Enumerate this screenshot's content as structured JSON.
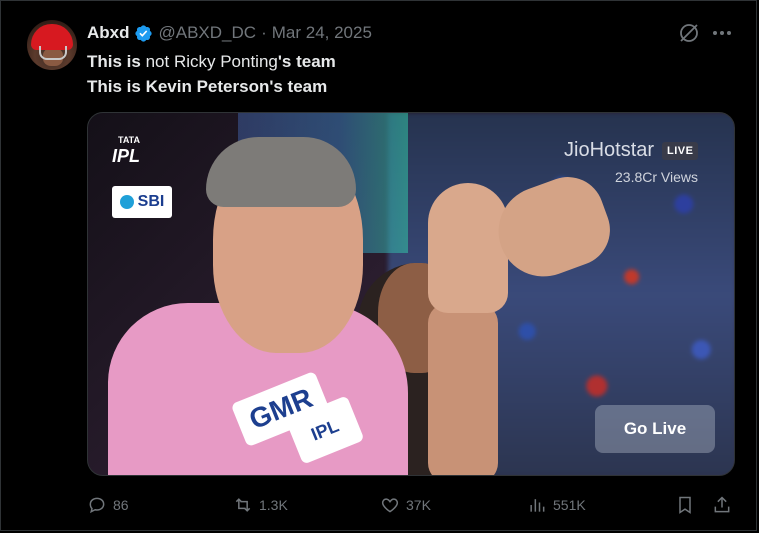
{
  "author": {
    "name": "Abxd",
    "handle": "@ABXD_DC",
    "separator": "·",
    "date": "Mar 24, 2025",
    "verified": true
  },
  "text": {
    "line1_bold_a": "This is",
    "line1_normal": " not Ricky Ponting",
    "line1_bold_b": "'s team",
    "line2": "This is Kevin Peterson's team"
  },
  "media": {
    "brand": "JioHotstar",
    "live_badge": "LIVE",
    "views": "23.8Cr Views",
    "go_live": "Go Live",
    "ipl_tata": "TATA",
    "ipl_label": "IPL",
    "sbi_label": "SBI",
    "jersey_sponsor": "GMR",
    "jersey_badge": "IPL"
  },
  "actions": {
    "replies": "86",
    "reposts": "1.3K",
    "likes": "37K",
    "views": "551K"
  },
  "icons": {
    "verified": "verified-badge-icon",
    "grok": "grok-icon",
    "more": "more-icon",
    "reply": "reply-icon",
    "repost": "repost-icon",
    "like": "heart-icon",
    "views": "views-bar-icon",
    "bookmark": "bookmark-icon",
    "share": "share-icon"
  },
  "colors": {
    "background": "#000000",
    "text": "#e7e9ea",
    "muted": "#71767b",
    "verified": "#1d9bf0",
    "jersey": "#e79ac5"
  }
}
